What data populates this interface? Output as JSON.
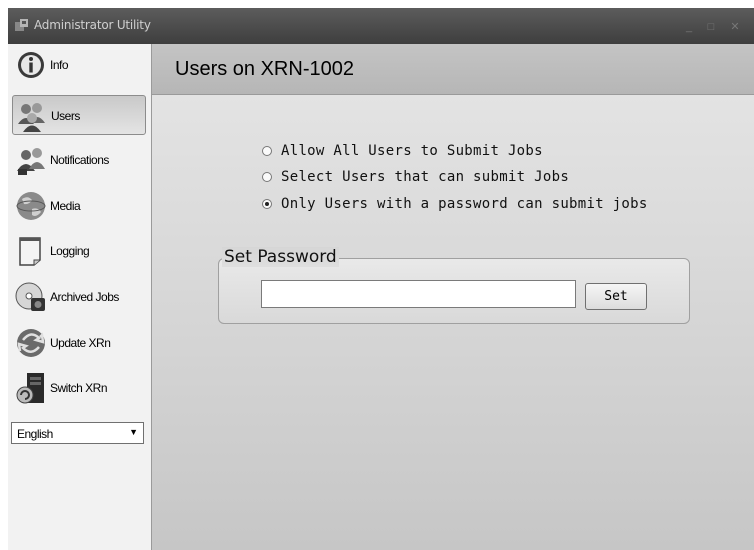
{
  "window": {
    "title": "Administrator Utility",
    "controls": {
      "minimize": "_",
      "maximize": "□",
      "close": "✕"
    }
  },
  "sidebar": {
    "items": [
      {
        "label": "Info",
        "icon": "info-icon",
        "selected": false
      },
      {
        "label": "Users",
        "icon": "users-icon",
        "selected": true
      },
      {
        "label": "Notifications",
        "icon": "notifications-icon",
        "selected": false
      },
      {
        "label": "Media",
        "icon": "media-globe-icon",
        "selected": false
      },
      {
        "label": "Logging",
        "icon": "logging-notepad-icon",
        "selected": false
      },
      {
        "label": "Archived Jobs",
        "icon": "archived-jobs-disc-icon",
        "selected": false
      },
      {
        "label": "Update XRn",
        "icon": "update-icon",
        "selected": false
      },
      {
        "label": "Switch XRn",
        "icon": "switch-icon",
        "selected": false
      }
    ],
    "language": {
      "value": "English"
    }
  },
  "main": {
    "title": "Users on XRN-1002",
    "options": [
      {
        "label": "Allow All Users to Submit Jobs",
        "checked": false
      },
      {
        "label": "Select Users that can submit Jobs",
        "checked": false
      },
      {
        "label": "Only Users with a password can submit jobs",
        "checked": true
      }
    ],
    "password_group": {
      "title": "Set Password",
      "input_value": "",
      "button_label": "Set"
    }
  }
}
